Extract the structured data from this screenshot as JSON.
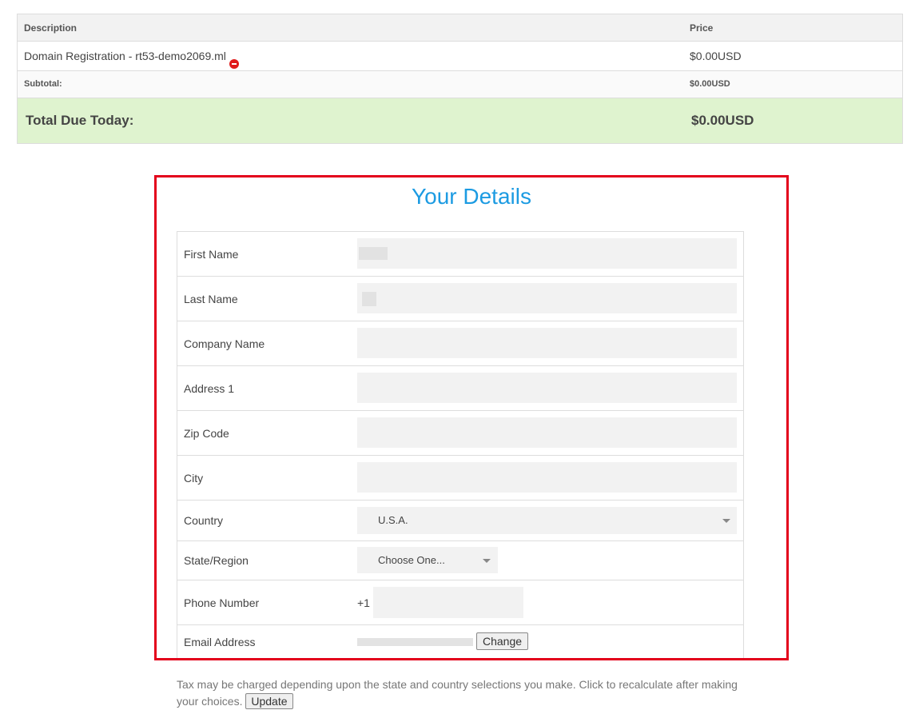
{
  "summary": {
    "header": {
      "description": "Description",
      "price": "Price"
    },
    "item": {
      "description": "Domain Registration - rt53-demo2069.ml",
      "price": "$0.00USD",
      "remove_icon": "minus-circle-icon"
    },
    "subtotal": {
      "label": "Subtotal:",
      "price": "$0.00USD"
    },
    "total": {
      "label": "Total Due Today:",
      "price": "$0.00USD"
    }
  },
  "details": {
    "title": "Your Details",
    "fields": {
      "first_name": {
        "label": "First Name",
        "value": ""
      },
      "last_name": {
        "label": "Last Name",
        "value": ""
      },
      "company": {
        "label": "Company Name",
        "value": ""
      },
      "address1": {
        "label": "Address 1",
        "value": ""
      },
      "zip": {
        "label": "Zip Code",
        "value": ""
      },
      "city": {
        "label": "City",
        "value": ""
      },
      "country": {
        "label": "Country",
        "value": "U.S.A."
      },
      "state": {
        "label": "State/Region",
        "value": "Choose One..."
      },
      "phone": {
        "label": "Phone Number",
        "prefix": "+1",
        "value": ""
      },
      "email": {
        "label": "Email Address",
        "change_label": "Change"
      }
    }
  },
  "tax_note": {
    "text": "Tax may be charged depending upon the state and country selections you make. Click to recalculate after making your choices.",
    "update_label": "Update"
  },
  "colors": {
    "title": "#1c9be2",
    "highlight_border": "#e3001b",
    "total_bg": "#dff3cf",
    "remove_icon": "#e01b1b"
  }
}
